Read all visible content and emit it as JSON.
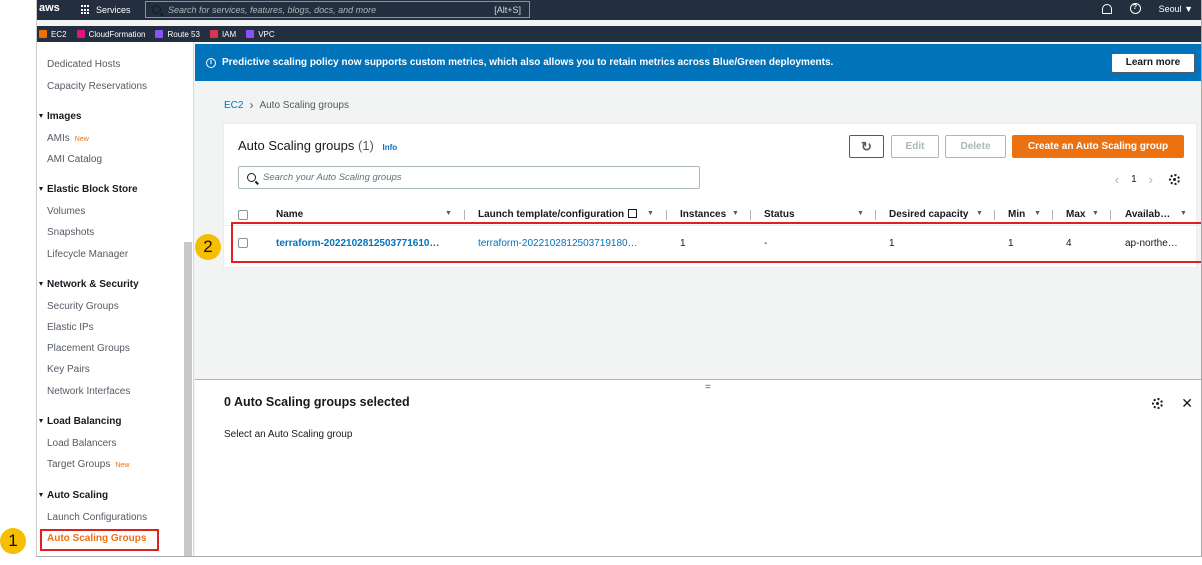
{
  "topnav": {
    "logo": "aws",
    "services_label": "Services",
    "search_placeholder": "Search for services, features, blogs, docs, and more",
    "search_shortcut": "[Alt+S]",
    "region": "Seoul ▼"
  },
  "favorites": [
    {
      "label": "EC2",
      "color": "#ed7100"
    },
    {
      "label": "CloudFormation",
      "color": "#e7157b"
    },
    {
      "label": "Route 53",
      "color": "#8c4fff"
    },
    {
      "label": "IAM",
      "color": "#dd344c"
    },
    {
      "label": "VPC",
      "color": "#8c4fff"
    }
  ],
  "sidebar": {
    "items": [
      {
        "label": "Dedicated Hosts"
      },
      {
        "label": "Capacity Reservations"
      },
      {
        "label": "Images",
        "heading": true
      },
      {
        "label": "AMIs",
        "badge": "New"
      },
      {
        "label": "AMI Catalog"
      },
      {
        "label": "Elastic Block Store",
        "heading": true
      },
      {
        "label": "Volumes"
      },
      {
        "label": "Snapshots"
      },
      {
        "label": "Lifecycle Manager"
      },
      {
        "label": "Network & Security",
        "heading": true
      },
      {
        "label": "Security Groups"
      },
      {
        "label": "Elastic IPs"
      },
      {
        "label": "Placement Groups"
      },
      {
        "label": "Key Pairs"
      },
      {
        "label": "Network Interfaces"
      },
      {
        "label": "Load Balancing",
        "heading": true
      },
      {
        "label": "Load Balancers"
      },
      {
        "label": "Target Groups",
        "badge": "New"
      },
      {
        "label": "Auto Scaling",
        "heading": true
      },
      {
        "label": "Launch Configurations"
      },
      {
        "label": "Auto Scaling Groups",
        "active": true
      }
    ]
  },
  "banner": {
    "text": "Predictive scaling policy now supports custom metrics, which also allows you to retain metrics across Blue/Green deployments.",
    "button": "Learn more"
  },
  "breadcrumb": {
    "root": "EC2",
    "current": "Auto Scaling groups"
  },
  "panel": {
    "title": "Auto Scaling groups",
    "count": "(1)",
    "info": "Info",
    "edit": "Edit",
    "delete": "Delete",
    "create": "Create an Auto Scaling group",
    "search_placeholder": "Search your Auto Scaling groups",
    "page": "1",
    "columns": [
      "Name",
      "Launch template/configuration",
      "Instances",
      "Status",
      "Desired capacity",
      "Min",
      "Max",
      "Availab…"
    ],
    "rows": [
      {
        "name": "terraform-2022102812503771610…",
        "launch": "terraform-2022102812503719180…",
        "instances": "1",
        "status": "-",
        "desired": "1",
        "min": "1",
        "max": "4",
        "az": "ap-northe…"
      }
    ]
  },
  "details": {
    "title": "0 Auto Scaling groups selected",
    "subtitle": "Select an Auto Scaling group"
  },
  "annotations": {
    "one": "1",
    "two": "2"
  },
  "colors": {
    "accent": "#ec7211",
    "link": "#0073bb",
    "nav": "#232f3e",
    "highlight": "#e01f1f",
    "badge": "#f5bf00"
  }
}
